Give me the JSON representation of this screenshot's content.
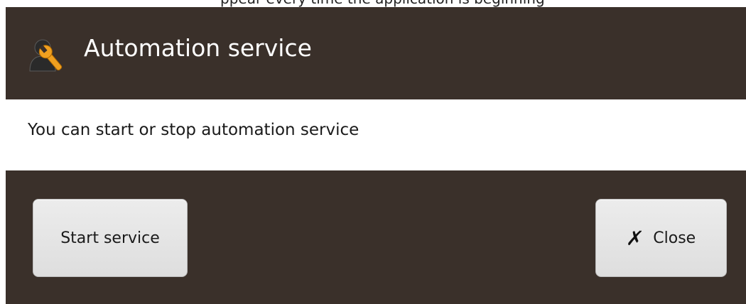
{
  "top_strip": {
    "clipped_text": "ppear every time the application is beginning"
  },
  "dialog": {
    "title": "Automation service",
    "header_icon": "user-wrench-icon",
    "message": "You can start or stop automation service",
    "buttons": {
      "start_label": "Start service",
      "close_label": "Close",
      "close_icon": "x-mark-icon"
    }
  },
  "colors": {
    "dialog_background": "#3a302a",
    "message_background": "#ffffff",
    "button_background": "#e6e6e6",
    "title_text": "#ffffff",
    "wrench_accent": "#f0a020"
  }
}
